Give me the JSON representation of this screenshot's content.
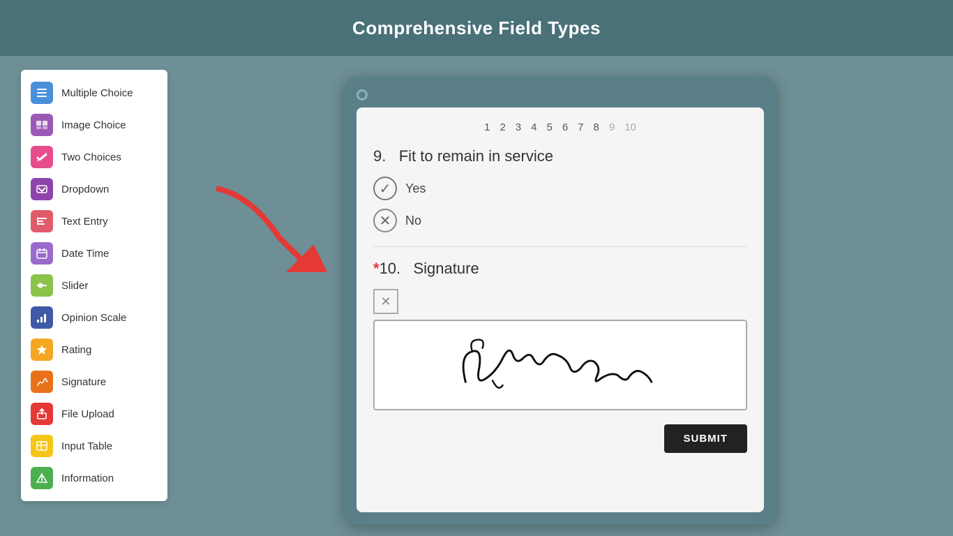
{
  "header": {
    "title": "Comprehensive Field Types"
  },
  "sidebar": {
    "items": [
      {
        "id": "multiple-choice",
        "label": "Multiple Choice",
        "iconClass": "ic-multiple",
        "icon": "☰"
      },
      {
        "id": "image-choice",
        "label": "Image Choice",
        "iconClass": "ic-image",
        "icon": "🖼"
      },
      {
        "id": "two-choices",
        "label": "Two Choices",
        "iconClass": "ic-twochoices",
        "icon": "✓✗"
      },
      {
        "id": "dropdown",
        "label": "Dropdown",
        "iconClass": "ic-dropdown",
        "icon": "▼"
      },
      {
        "id": "text-entry",
        "label": "Text Entry",
        "iconClass": "ic-textentry",
        "icon": "I"
      },
      {
        "id": "date-time",
        "label": "Date Time",
        "iconClass": "ic-datetime",
        "icon": "📅"
      },
      {
        "id": "slider",
        "label": "Slider",
        "iconClass": "ic-slider",
        "icon": "⇔"
      },
      {
        "id": "opinion-scale",
        "label": "Opinion Scale",
        "iconClass": "ic-opinion",
        "icon": "▦"
      },
      {
        "id": "rating",
        "label": "Rating",
        "iconClass": "ic-rating",
        "icon": "★"
      },
      {
        "id": "signature",
        "label": "Signature",
        "iconClass": "ic-signature",
        "icon": "✎"
      },
      {
        "id": "file-upload",
        "label": "File Upload",
        "iconClass": "ic-fileupload",
        "icon": "📤"
      },
      {
        "id": "input-table",
        "label": "Input Table",
        "iconClass": "ic-inputtable",
        "icon": "▦"
      },
      {
        "id": "information",
        "label": "Information",
        "iconClass": "ic-information",
        "icon": "ℹ"
      }
    ]
  },
  "preview": {
    "pageNumbers": [
      "1",
      "2",
      "3",
      "4",
      "5",
      "6",
      "7",
      "8",
      "9",
      "10"
    ],
    "activePages": [
      "1",
      "2",
      "3",
      "4",
      "5",
      "6",
      "7",
      "8"
    ],
    "question9": {
      "number": "9.",
      "text": "Fit to remain in service",
      "choices": [
        {
          "label": "Yes",
          "state": "check"
        },
        {
          "label": "No",
          "state": "x"
        }
      ]
    },
    "question10": {
      "required": "*",
      "number": "10.",
      "text": "Signature"
    },
    "submitLabel": "SUBMIT"
  }
}
